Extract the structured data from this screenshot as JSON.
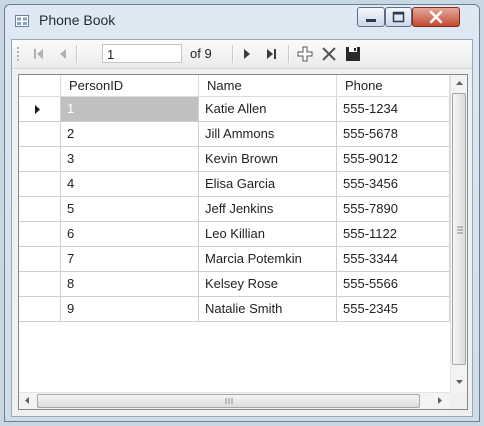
{
  "window": {
    "title": "Phone Book"
  },
  "toolbar": {
    "position": "1",
    "count_label": "of 9"
  },
  "grid": {
    "columns": [
      "PersonID",
      "Name",
      "Phone"
    ],
    "rows": [
      [
        "1",
        "Katie Allen",
        "555-1234"
      ],
      [
        "2",
        "Jill Ammons",
        "555-5678"
      ],
      [
        "3",
        "Kevin Brown",
        "555-9012"
      ],
      [
        "4",
        "Elisa Garcia",
        "555-3456"
      ],
      [
        "5",
        "Jeff Jenkins",
        "555-7890"
      ],
      [
        "6",
        "Leo Killian",
        "555-1122"
      ],
      [
        "7",
        "Marcia Potemkin",
        "555-3344"
      ],
      [
        "8",
        "Kelsey Rose",
        "555-5566"
      ],
      [
        "9",
        "Natalie Smith",
        "555-2345"
      ]
    ],
    "selected_row": 1
  },
  "icons": [
    "app-icon",
    "minimize-icon",
    "maximize-icon",
    "close-icon",
    "move-first-icon",
    "move-previous-icon",
    "move-next-icon",
    "move-last-icon",
    "add-new-icon",
    "delete-icon",
    "save-icon",
    "current-row-icon"
  ]
}
